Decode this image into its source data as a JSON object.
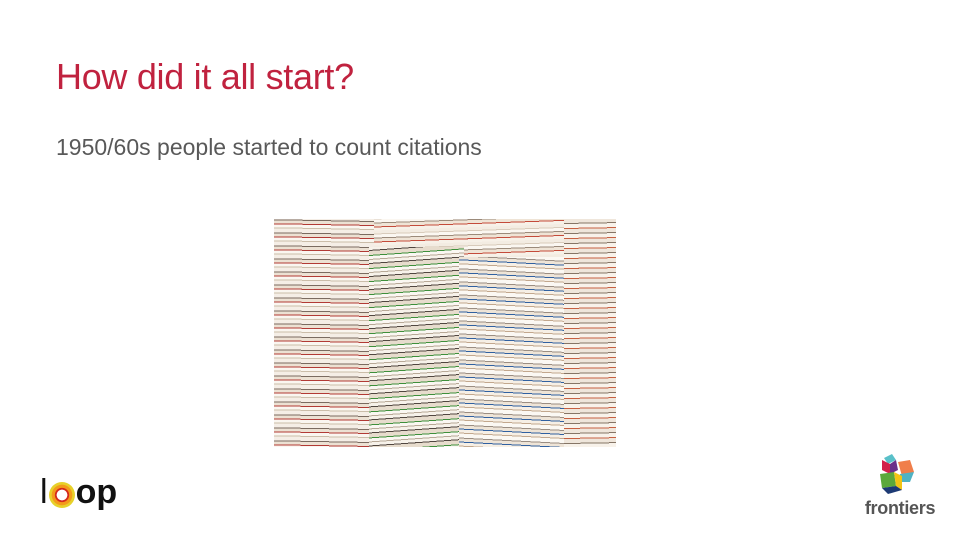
{
  "slide": {
    "title": "How did it all start?",
    "body": "1950/60s people started to count citations",
    "image": "stacks-of-magazines-photo",
    "logos": {
      "left": "loop",
      "right": "frontiers"
    },
    "colors": {
      "title": "#c0223f",
      "body": "#595959"
    }
  }
}
